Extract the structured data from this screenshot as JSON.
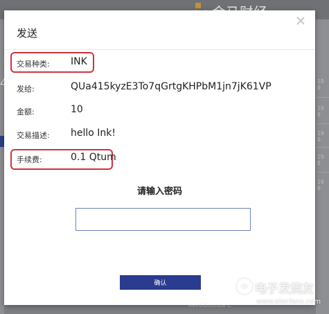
{
  "background": {
    "logo_text": "金马财经",
    "side_timestamps": [
      "19 0",
      "19 0",
      "19 0",
      "19 0",
      "19 0"
    ],
    "left_glyph": "4",
    "footer_text": "Revolutionize C"
  },
  "modal": {
    "title": "发送",
    "fields": [
      {
        "label": "交易种类:",
        "value": "INK"
      },
      {
        "label": "发给:",
        "value": "QUa415kyzE3To7qGrtgKHPbM1jn7jK61VP"
      },
      {
        "label": "金额:",
        "value": "10"
      },
      {
        "label": "交易描述:",
        "value": "hello Ink!"
      },
      {
        "label": "手续费:",
        "value": "0.1 Qtum"
      }
    ],
    "password_prompt": "请输入密码",
    "password_value": "",
    "confirm_label": "确认"
  },
  "watermark": {
    "title": "电子发烧友",
    "url": "www.elecfans.com"
  },
  "colors": {
    "accent": "#2a3c8f",
    "highlight": "#d2313a",
    "logo": "#c6903a"
  }
}
